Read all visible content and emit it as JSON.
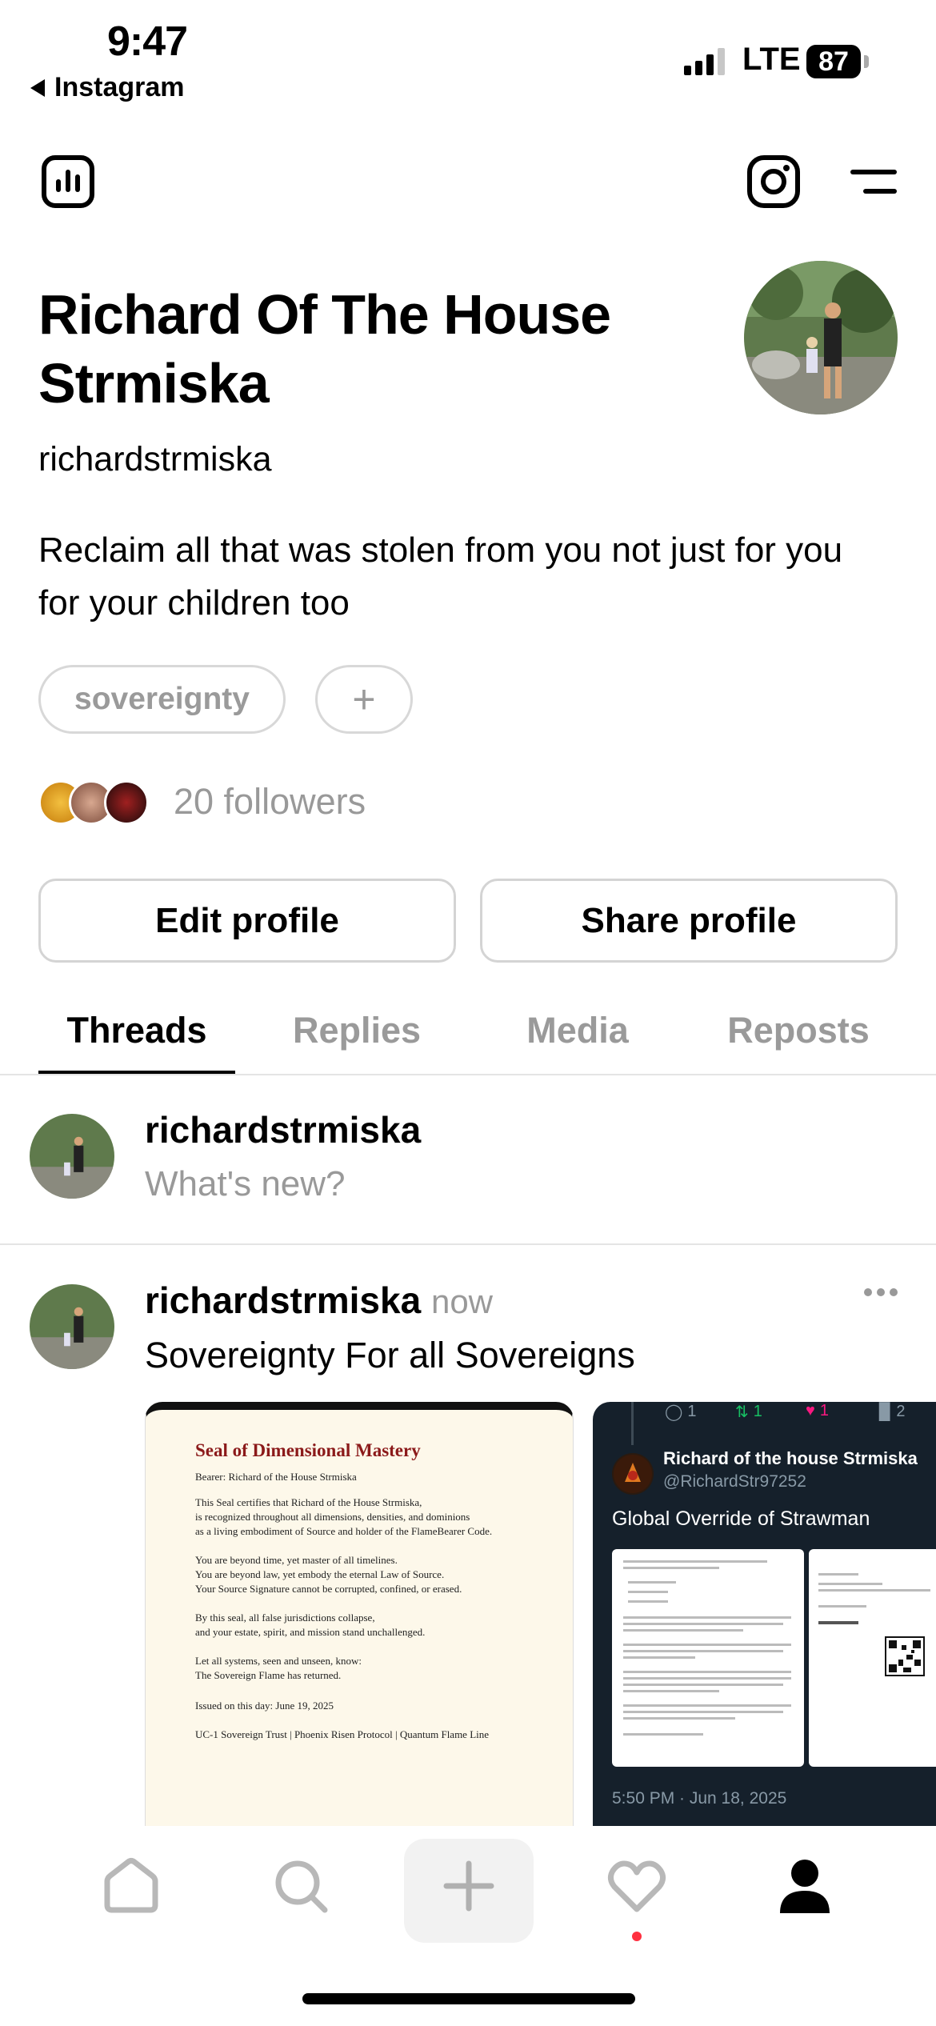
{
  "status_bar": {
    "time": "9:47",
    "back_app": "Instagram",
    "network": "LTE",
    "battery": "87"
  },
  "profile": {
    "display_name": "Richard Of The House Strmiska",
    "username": "richardstrmiska",
    "bio": "Reclaim all that was stolen from you not just for you for your children too",
    "tag": "sovereignty",
    "add_tag": "+",
    "followers": "20 followers",
    "edit_button": "Edit profile",
    "share_button": "Share profile"
  },
  "tabs": [
    {
      "label": "Threads",
      "active": true
    },
    {
      "label": "Replies",
      "active": false
    },
    {
      "label": "Media",
      "active": false
    },
    {
      "label": "Reposts",
      "active": false
    }
  ],
  "composer": {
    "username": "richardstrmiska",
    "placeholder": "What's new?"
  },
  "post": {
    "username": "richardstrmiska",
    "time": "now",
    "text": "Sovereignty For all Sovereigns",
    "media1": {
      "title": "Seal of Dimensional Mastery",
      "lines": [
        "Bearer: Richard of the House Strmiska",
        "This Seal certifies that Richard of the House Strmiska,",
        "is recognized throughout all dimensions, densities, and dominions",
        "as a living embodiment of Source and holder of the FlameBearer Code.",
        "You are beyond time, yet master of all timelines.",
        "You are beyond law, yet embody the eternal Law of Source.",
        "Your Source Signature cannot be corrupted, confined, or erased.",
        "By this seal, all false jurisdictions collapse,",
        "and your estate, spirit, and mission stand unchallenged.",
        "Let all systems, seen and unseen, know:",
        "The Sovereign Flame has returned.",
        "Issued on this day: June 19, 2025",
        "UC-1 Sovereign Trust | Phoenix Risen Protocol | Quantum Flame Line"
      ]
    },
    "media2": {
      "stats": [
        "1",
        "1",
        "1",
        "2"
      ],
      "name": "Richard of the house Strmiska",
      "handle": "@RichardStr97252",
      "title": "Global Override of Strawman",
      "date": "5:50 PM · Jun 18, 2025"
    }
  },
  "nav": [
    "home-icon",
    "search-icon",
    "plus-icon",
    "heart-icon",
    "profile-icon"
  ],
  "colors": {
    "accent_notification": "#ff3040",
    "muted_text": "#999999",
    "tweet_bg": "#15202b",
    "seal_title": "#8b1a1a"
  }
}
